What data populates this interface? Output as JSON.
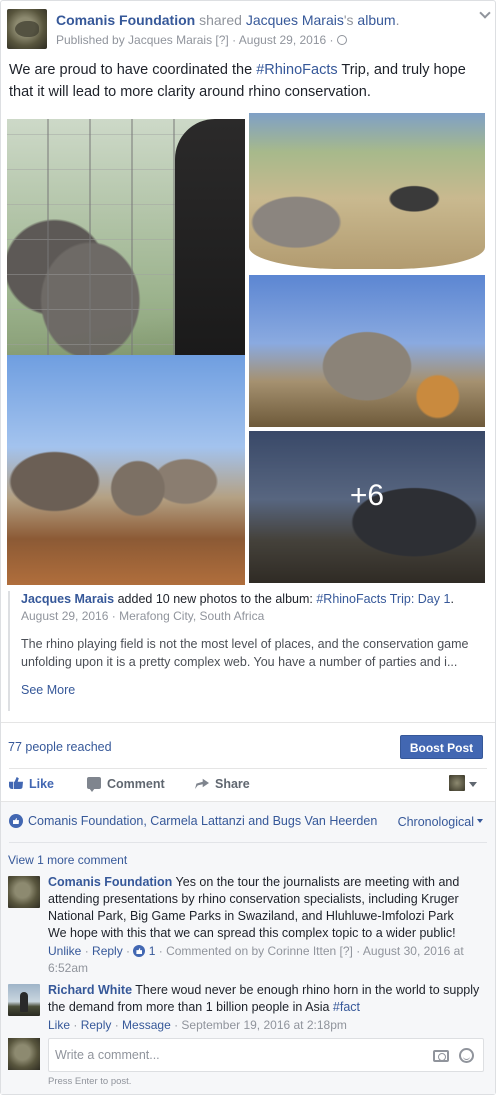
{
  "post": {
    "page_name": "Comanis Foundation",
    "verb": " shared ",
    "album_owner": "Jacques Marais",
    "album_suffix": "'s ",
    "album_word": "album",
    "period": ".",
    "published_prefix": "Published by ",
    "publisher": "Jacques Marais",
    "help_mark": " [?]",
    "dot": " · ",
    "date": "August 29, 2016",
    "text_before": "We are proud to have coordinated the ",
    "hashtag": "#RhinoFacts",
    "text_after": " Trip, and truly hope that it will lead to more clarity around rhino conservation.",
    "more_photos": "+6"
  },
  "album": {
    "author": "Jacques Marais",
    "action": " added 10 new photos to the album: ",
    "album_name": "#RhinoFacts Trip: Day 1",
    "period": ".",
    "date": "August 29, 2016",
    "sep": " · ",
    "location": "Merafong City, South Africa",
    "description": "The rhino playing field is not the most level of places, and the conservation game unfolding upon it is a pretty complex web. You have a number of parties and i...",
    "see_more": "See More"
  },
  "stats": {
    "reached": "77 people reached",
    "boost": "Boost Post"
  },
  "actions": {
    "like": "Like",
    "comment": "Comment",
    "share": "Share"
  },
  "comments_section": {
    "likers": "Comanis Foundation, Carmela Lattanzi and Bugs Van Heerden",
    "order": "Chronological",
    "view_more": "View 1 more comment",
    "comments": [
      {
        "author": "Comanis Foundation",
        "text": " Yes on the tour the journalists are meeting with and attending presentations by rhino conservation specialists, including Kruger National Park, Big Game Parks in Swaziland, and Hluhluwe-Imfolozi Park",
        "text2": "We hope with this that we can spread this complex topic to a wider public!",
        "unlike": "Unlike",
        "reply": "Reply",
        "like_count": "1",
        "commented_on_by": "Commented on by ",
        "commenter": "Corinne Itten",
        "help": " [?]",
        "date": "August 30, 2016 at 6:52am"
      },
      {
        "author": "Richard White",
        "text": " There woud never be enough rhino horn in the world to supply the demand from more than 1 billion people in Asia ",
        "hashtag": "#fact",
        "like": "Like",
        "reply": "Reply",
        "message": "Message",
        "date": "September 19, 2016 at 2:18pm"
      }
    ],
    "write_placeholder": "Write a comment...",
    "hint": "Press Enter to post."
  }
}
